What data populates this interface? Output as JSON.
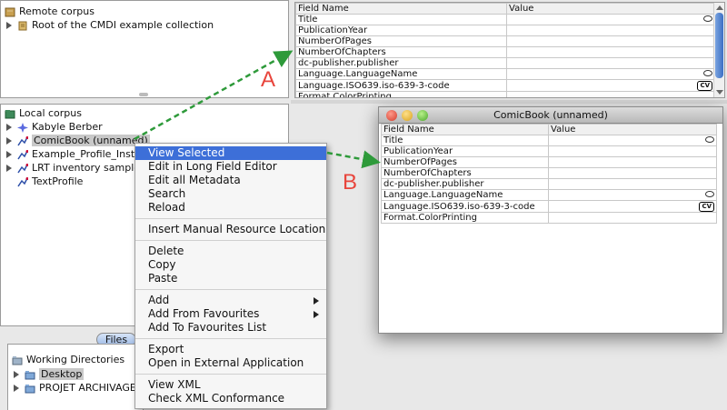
{
  "remote_corpus": {
    "header": "Remote corpus",
    "items": [
      {
        "label": "Root of the CMDI example collection"
      }
    ]
  },
  "local_corpus": {
    "header": "Local corpus",
    "items": [
      {
        "label": "Kabyle Berber"
      },
      {
        "label": "ComicBook (unnamed)"
      },
      {
        "label": "Example_Profile_Insta"
      },
      {
        "label": "LRT inventory sample"
      },
      {
        "label": "TextProfile"
      }
    ]
  },
  "files_tab": {
    "label": "Files"
  },
  "working_dirs": {
    "header": "Working Directories",
    "items": [
      {
        "label": "Desktop"
      },
      {
        "label": "PROJET ARCHIVAGES I"
      }
    ]
  },
  "metadata_table": {
    "columns": [
      "Field Name",
      "Value"
    ],
    "rows": [
      {
        "field": "Title",
        "badge": "bubble"
      },
      {
        "field": "PublicationYear",
        "badge": ""
      },
      {
        "field": "NumberOfPages",
        "badge": ""
      },
      {
        "field": "NumberOfChapters",
        "badge": ""
      },
      {
        "field": "dc-publisher.publisher",
        "badge": ""
      },
      {
        "field": "Language.LanguageName",
        "badge": "bubble"
      },
      {
        "field": "Language.ISO639.iso-639-3-code",
        "badge": "CV"
      },
      {
        "field": "Format.ColorPrinting",
        "badge": ""
      }
    ]
  },
  "context_menu": {
    "groups": [
      [
        "View Selected",
        "Edit in Long Field Editor",
        "Edit all Metadata",
        "Search",
        "Reload"
      ],
      [
        "Insert Manual Resource Location"
      ],
      [
        "Delete",
        "Copy",
        "Paste"
      ],
      [
        "Add",
        "Add From Favourites",
        "Add To Favourites List"
      ],
      [
        "Export",
        "Open in External Application"
      ],
      [
        "View XML",
        "Check XML Conformance"
      ]
    ],
    "selected": "View Selected",
    "submenu_items": [
      "Add",
      "Add From Favourites"
    ]
  },
  "floating_window": {
    "title": "ComicBook (unnamed)",
    "columns": [
      "Field Name",
      "Value"
    ],
    "rows": [
      {
        "field": "Title",
        "badge": "bubble"
      },
      {
        "field": "PublicationYear",
        "badge": ""
      },
      {
        "field": "NumberOfPages",
        "badge": ""
      },
      {
        "field": "NumberOfChapters",
        "badge": ""
      },
      {
        "field": "dc-publisher.publisher",
        "badge": ""
      },
      {
        "field": "Language.LanguageName",
        "badge": "bubble"
      },
      {
        "field": "Language.ISO639.iso-639-3-code",
        "badge": "CV"
      },
      {
        "field": "Format.ColorPrinting",
        "badge": ""
      }
    ]
  },
  "annotations": {
    "a": "A",
    "b": "B"
  },
  "colors": {
    "selection": "#3d6fd8",
    "annotation_red": "#e8453c",
    "arrow_green": "#2e9a3a"
  }
}
